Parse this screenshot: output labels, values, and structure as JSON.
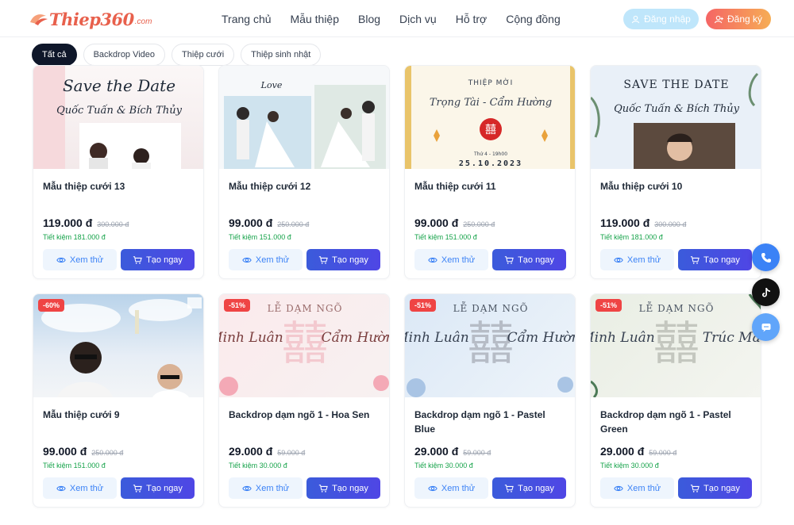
{
  "header": {
    "logo_text": "Thiep360",
    "logo_suffix": ".com",
    "nav": [
      "Trang chủ",
      "Mẫu thiệp",
      "Blog",
      "Dịch vụ",
      "Hỗ trợ",
      "Cộng đồng"
    ],
    "login_label": "Đăng nhập",
    "register_label": "Đăng ký"
  },
  "tabs": [
    {
      "label": "Tất cả",
      "active": true
    },
    {
      "label": "Backdrop Video",
      "active": false
    },
    {
      "label": "Thiệp cưới",
      "active": false
    },
    {
      "label": "Thiệp sinh nhật",
      "active": false
    }
  ],
  "cards": [
    {
      "title": "Mẫu thiệp cưới 13",
      "price": "119.000 đ",
      "old_price": "300.000 đ",
      "save": "Tiết kiệm 181.000 đ",
      "badge": "",
      "art": {
        "top": "Save the Date",
        "names": "Quốc Tuấn & Bích Thủy"
      }
    },
    {
      "title": "Mẫu thiệp cưới 12",
      "price": "99.000 đ",
      "old_price": "250.000 đ",
      "save": "Tiết kiệm 151.000 đ",
      "badge": "",
      "art": {
        "top": "Love",
        "names": ""
      }
    },
    {
      "title": "Mẫu thiệp cưới 11",
      "price": "99.000 đ",
      "old_price": "250.000 đ",
      "save": "Tiết kiệm 151.000 đ",
      "badge": "",
      "art": {
        "top": "THIỆP MỜI",
        "names": "Trọng Tài - Cẩm Hường",
        "time": "Thứ 4 - 19h00",
        "date": "25.10.2023"
      }
    },
    {
      "title": "Mẫu thiệp cưới 10",
      "price": "119.000 đ",
      "old_price": "300.000 đ",
      "save": "Tiết kiệm 181.000 đ",
      "badge": "",
      "art": {
        "top": "SAVE THE DATE",
        "names": "Quốc Tuấn & Bích Thủy"
      }
    },
    {
      "title": "Mẫu thiệp cưới 9",
      "price": "99.000 đ",
      "old_price": "250.000 đ",
      "save": "Tiết kiệm 151.000 đ",
      "badge": "-60%",
      "art": {
        "top": "",
        "names": ""
      }
    },
    {
      "title": "Backdrop dạm ngõ 1 - Hoa Sen",
      "price": "29.000 đ",
      "old_price": "59.000 đ",
      "save": "Tiết kiệm 30.000 đ",
      "badge": "-51%",
      "art": {
        "top": "LỄ DẠM NGÕ",
        "left": "Minh Luân",
        "right": "Cẩm Hường"
      }
    },
    {
      "title": "Backdrop dạm ngõ 1 - Pastel Blue",
      "price": "29.000 đ",
      "old_price": "59.000 đ",
      "save": "Tiết kiệm 30.000 đ",
      "badge": "-51%",
      "art": {
        "top": "LỄ DẠM NGÕ",
        "left": "Minh Luân",
        "right": "Cẩm Hường"
      }
    },
    {
      "title": "Backdrop dạm ngõ 1 - Pastel Green",
      "price": "29.000 đ",
      "old_price": "59.000 đ",
      "save": "Tiết kiệm 30.000 đ",
      "badge": "-51%",
      "art": {
        "top": "LỄ DẠM NGÕ",
        "left": "Minh Luân",
        "right": "Trúc Mai"
      }
    }
  ],
  "card_buttons": {
    "view": "Xem thử",
    "make": "Tạo ngay"
  },
  "colors": {
    "accent": "#4f46e5",
    "danger": "#ef4444",
    "success": "#16a34a"
  },
  "float_icons": [
    "phone-icon",
    "tiktok-icon",
    "chat-icon"
  ]
}
